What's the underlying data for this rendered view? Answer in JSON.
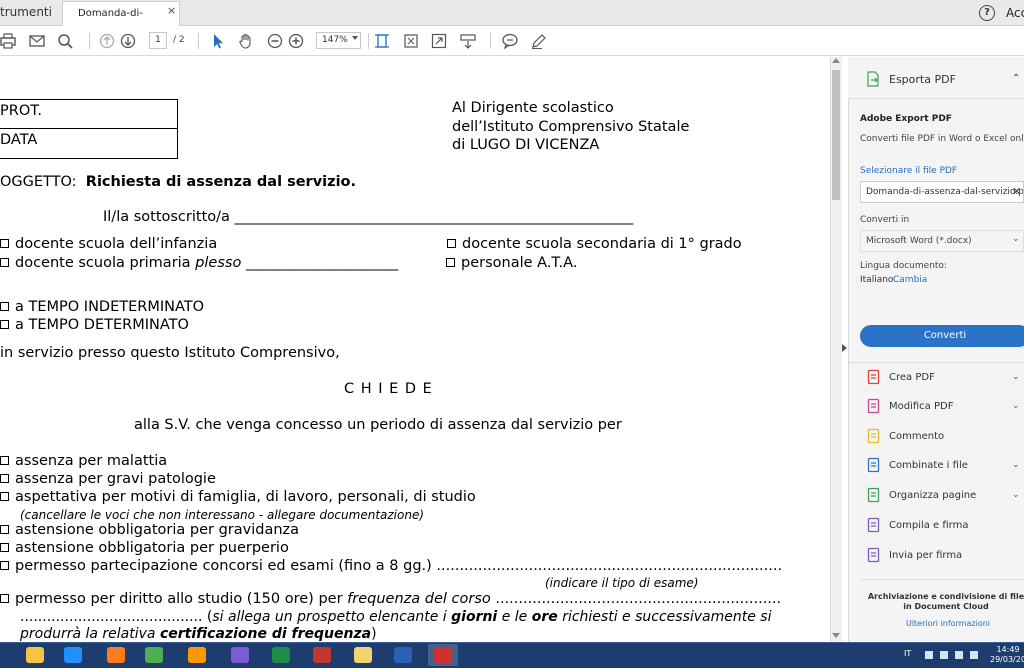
{
  "tabs": {
    "tools_label": "trumenti",
    "doc_tab_label": "Domanda-di-assen...",
    "close_glyph": "×",
    "help_glyph": "?",
    "account_label": "Acc"
  },
  "toolbar": {
    "page_current": "1",
    "page_total": "/ 2",
    "zoom": "147%",
    "icons": [
      "print-icon",
      "mail-icon",
      "search-icon",
      "page-up-icon",
      "page-down-icon",
      "select-arrow-icon",
      "hand-icon",
      "zoom-out-icon",
      "zoom-in-icon",
      "fit-width-icon",
      "fit-page-icon",
      "fullscreen-icon",
      "scroll-mode-icon",
      "comment-icon",
      "pen-icon"
    ]
  },
  "document": {
    "prot": "PROT.",
    "data": "DATA",
    "addr_1": "Al  Dirigente scolastico",
    "addr_2": "dell’Istituto Comprensivo Statale",
    "addr_3": "di    LUGO DI VICENZA",
    "oggetto_label": "OGGETTO:",
    "oggetto_text": "Richiesta di assenza dal servizio.",
    "sottoscritto": "Il/la sottoscritto/a _______________________________________________________",
    "opt_infanzia": "docente scuola dell’infanzia",
    "opt_secondaria": "docente scuola secondaria di 1° grado",
    "opt_primaria": "docente scuola primaria",
    "plesso_word": "plesso",
    "plesso_line": "_____________________",
    "opt_ata": "personale A.T.A.",
    "opt_indet": "a TEMPO INDETERMINATO",
    "opt_det": "a TEMPO DETERMINATO",
    "in_servizio": "in servizio presso questo Istituto Comprensivo,",
    "chiede": "C H I E D E",
    "alla_sv": "alla S.V. che venga concesso un periodo di assenza dal servizio per",
    "r1": "assenza per malattia",
    "r2": "assenza per gravi patologie",
    "r3": "aspettativa per motivi di famiglia, di lavoro, personali, di studio",
    "r3_note": "(cancellare le voci che non interessano -  allegare documentazione)",
    "r4": "astensione obbligatoria per gravidanza",
    "r5": "astensione obbligatoria per puerperio",
    "r6": "permesso partecipazione concorsi ed esami (fino a 8 gg.) ...........................................................................",
    "r6_note": "(indicare il tipo di esame)",
    "r7_a": "permesso per diritto allo studio (150 ore) per",
    "r7_b": "frequenza del corso",
    "r7_c": "..............................................................",
    "r8_a": "......................................... (",
    "r8_b": "si allega un prospetto elencante i",
    "r8_c": "giorni",
    "r8_d": "e le",
    "r8_e": "ore",
    "r8_f": "richiesti e successivamente si",
    "r9_a": "produrrà la relativa",
    "r9_b": "certificazione di frequenza",
    "r9_c": ")"
  },
  "rightpane": {
    "export_title": "Esporta PDF",
    "aep_title": "Adobe Export PDF",
    "aep_desc": "Converti file PDF in Word o Excel online",
    "select_label": "Selezionare il file PDF",
    "file_name": "Domanda-di-assenza-dal-servizio.pdf",
    "convert_to_label": "Converti in",
    "format": "Microsoft Word (*.docx)",
    "lang_label": "Lingua documento:",
    "lang_value": "Italiano",
    "lang_change": "Cambia",
    "convert_button": "Converti",
    "tools": [
      {
        "label": "Crea PDF",
        "icon": "create-pdf-icon",
        "color": "#d9423b"
      },
      {
        "label": "Modifica PDF",
        "icon": "edit-pdf-icon",
        "color": "#c2498e"
      },
      {
        "label": "Commento",
        "icon": "comment-icon",
        "color": "#e8b730"
      },
      {
        "label": "Combinate i file",
        "icon": "combine-files-icon",
        "color": "#2a73c9"
      },
      {
        "label": "Organizza pagine",
        "icon": "organize-pages-icon",
        "color": "#3aa356"
      },
      {
        "label": "Compila e firma",
        "icon": "fill-sign-icon",
        "color": "#7a5cc0"
      },
      {
        "label": "Invia per firma",
        "icon": "send-sign-icon",
        "color": "#7a5cc0"
      }
    ],
    "archive_text": "Archiviazione e condivisione di file in Document Cloud",
    "archive_link": "Ulteriori informazioni"
  },
  "taskbar": {
    "apps": [
      "folder-icon",
      "internet-explorer-icon",
      "firefox-icon",
      "chrome-icon",
      "media-player-icon",
      "network-icon",
      "excel-icon",
      "archive-icon",
      "file-explorer-icon",
      "word-icon",
      "acrobat-icon"
    ],
    "lang": "IT",
    "time": "14:49",
    "date": "29/03/20"
  }
}
